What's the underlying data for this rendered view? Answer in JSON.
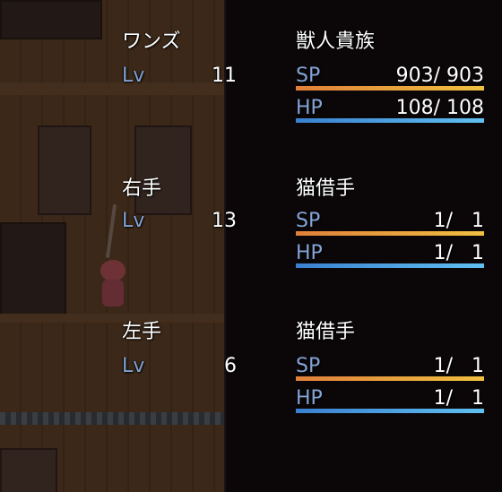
{
  "colors": {
    "sp_gauge": "#e8a040",
    "hp_gauge": "#4aa0e0",
    "stat_label": "#84a4d4"
  },
  "members": [
    {
      "name": "ワンズ",
      "lv_label": "Lv",
      "level": "11",
      "class": "獣人貴族",
      "sp_label": "SP",
      "sp_text": "903/ 903",
      "sp_ratio": 1.0,
      "hp_label": "HP",
      "hp_text": "108/ 108",
      "hp_ratio": 1.0
    },
    {
      "name": "右手",
      "lv_label": "Lv",
      "level": "13",
      "class": "猫借手",
      "sp_label": "SP",
      "sp_text": "1/   1",
      "sp_ratio": 1.0,
      "hp_label": "HP",
      "hp_text": "1/   1",
      "hp_ratio": 1.0
    },
    {
      "name": "左手",
      "lv_label": "Lv",
      "level": "6",
      "class": "猫借手",
      "sp_label": "SP",
      "sp_text": "1/   1",
      "sp_ratio": 1.0,
      "hp_label": "HP",
      "hp_text": "1/   1",
      "hp_ratio": 1.0
    }
  ]
}
